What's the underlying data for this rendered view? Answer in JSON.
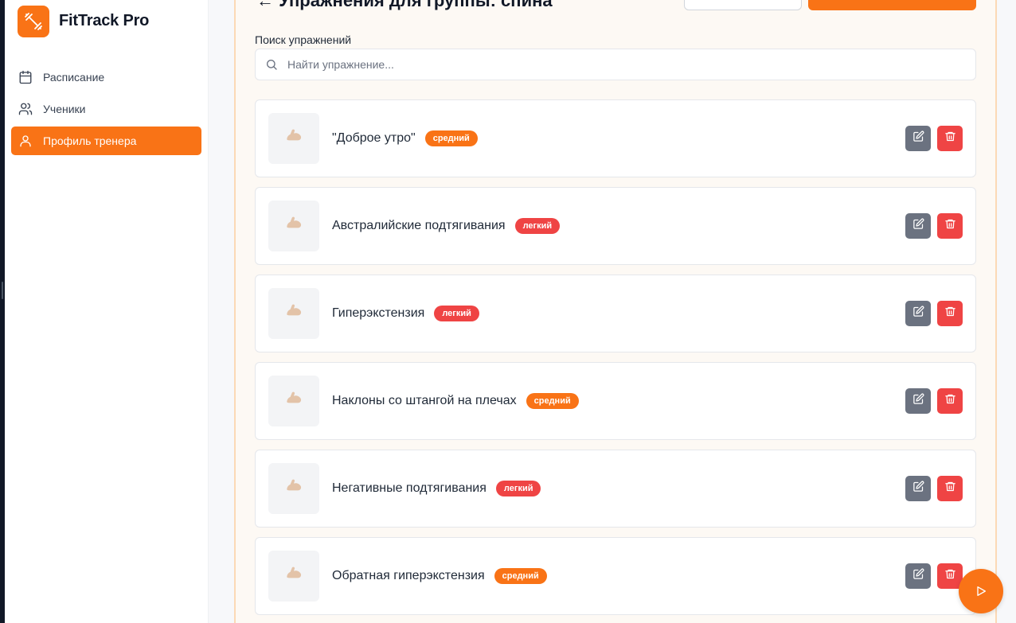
{
  "app": {
    "name": "FitTrack Pro"
  },
  "sidebar": {
    "items": [
      {
        "label": "Расписание",
        "icon": "calendar-icon",
        "active": false
      },
      {
        "label": "Ученики",
        "icon": "users-icon",
        "active": false
      },
      {
        "label": "Профиль тренера",
        "icon": "user-icon",
        "active": true
      }
    ]
  },
  "header": {
    "title": "Упражнения для группы: спина"
  },
  "search": {
    "label": "Поиск упражнений",
    "placeholder": "Найти упражнение...",
    "value": ""
  },
  "exercises": [
    {
      "name": "\"Доброе утро\"",
      "level": "средний",
      "level_type": "medium"
    },
    {
      "name": "Австралийские подтягивания",
      "level": "легкий",
      "level_type": "light"
    },
    {
      "name": "Гиперэкстензия",
      "level": "легкий",
      "level_type": "light"
    },
    {
      "name": "Наклоны со штангой на плечах",
      "level": "средний",
      "level_type": "medium"
    },
    {
      "name": "Негативные подтягивания",
      "level": "легкий",
      "level_type": "light"
    },
    {
      "name": "Обратная гиперэкстензия",
      "level": "средний",
      "level_type": "medium"
    }
  ],
  "colors": {
    "accent": "#f97316",
    "danger": "#ef4444",
    "muted_button": "#6b7280"
  }
}
